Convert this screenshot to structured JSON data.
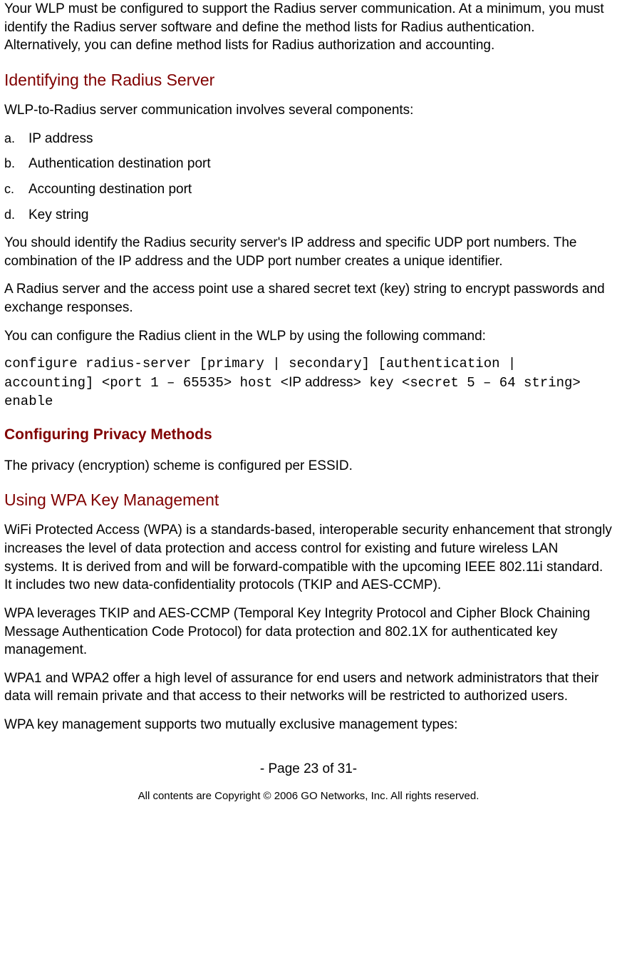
{
  "intro": "Your WLP must be configured to support the Radius server communication. At a minimum, you must identify the Radius server software and define the method lists for Radius authentication. Alternatively, you can define method lists for Radius authorization and accounting.",
  "h_identify": "Identifying the Radius Server",
  "p_identify_intro": "WLP-to-Radius server communication involves several components:",
  "list": {
    "a_marker": "a.",
    "a": "IP address",
    "b_marker": "b.",
    "b": "Authentication destination port",
    "c_marker": "c.",
    "c": "Accounting destination port",
    "d_marker": "d.",
    "d": "Key string"
  },
  "p_identify_1": "You should identify the Radius security server's IP address and specific UDP port numbers. The combination of the IP address and the UDP port number creates a unique identifier.",
  "p_identify_2": "A Radius server and the access point use a shared secret text (key) string to encrypt passwords and exchange responses.",
  "p_identify_3": "You can configure the Radius client in the WLP by using the following command:",
  "cmd_part1": "configure radius-server [primary | secondary] [authentication | accounting] <port  1 – 65535> host <",
  "cmd_ip": "IP address",
  "cmd_part2": "> key <secret 5 – 64 string> enable",
  "h_privacy": "Configuring Privacy Methods",
  "p_privacy": "The privacy (encryption) scheme is configured per ESSID.",
  "h_wpa": "Using WPA Key Management",
  "p_wpa_1": "WiFi Protected Access (WPA) is a standards-based, interoperable security enhancement that strongly increases the level of data protection and access control for existing and future wireless LAN systems. It is derived from and will be forward-compatible with the upcoming IEEE 802.11i standard. It includes two new data-confidentiality protocols (TKIP and AES-CCMP).",
  "p_wpa_2": "WPA leverages TKIP and AES-CCMP (Temporal Key Integrity Protocol and Cipher Block Chaining Message Authentication Code Protocol) for data protection and 802.1X for authenticated key management.",
  "p_wpa_3": "WPA1 and WPA2 offer a high level of assurance for end users and network administrators that their data will remain private and that access to their networks will be restricted to authorized users.",
  "p_wpa_4": "WPA key management supports two mutually exclusive management types:",
  "page_num": "- Page 23 of 31-",
  "copyright": "All contents are Copyright © 2006 GO Networks, Inc. All rights reserved."
}
